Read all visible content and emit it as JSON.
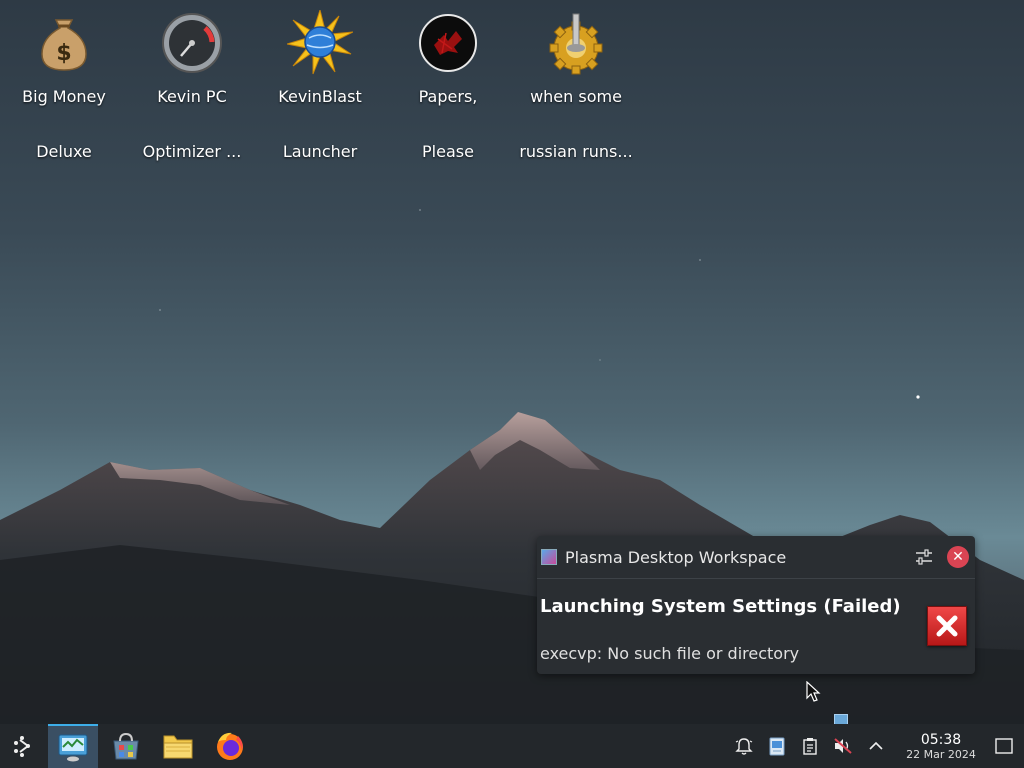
{
  "desktop": {
    "icons": [
      {
        "line1": "Big Money",
        "line2": "Deluxe",
        "icon": "money-bag-icon"
      },
      {
        "line1": "Kevin PC",
        "line2": "Optimizer ...",
        "icon": "speedometer-icon"
      },
      {
        "line1": "KevinBlast",
        "line2": "Launcher",
        "icon": "globe-starburst-icon"
      },
      {
        "line1": "Papers,",
        "line2": "Please",
        "icon": "papers-please-icon"
      },
      {
        "line1": "when some",
        "line2": "russian runs...",
        "icon": "gear-joystick-icon"
      }
    ]
  },
  "notification": {
    "app_name": "Plasma Desktop Workspace",
    "title": "Launching System Settings (Failed)",
    "body": "execvp: No such file or directory",
    "icon": "error-x-icon"
  },
  "taskbar": {
    "launcher_icon": "application-launcher-icon",
    "tasks": [
      {
        "icon": "system-monitor-icon",
        "active": true
      },
      {
        "icon": "software-store-icon",
        "active": false
      },
      {
        "icon": "file-manager-icon",
        "active": false
      },
      {
        "icon": "firefox-icon",
        "active": false
      }
    ],
    "tray": [
      "notifications-bell-icon",
      "clipboard-icon-blue",
      "clipboard-icon",
      "volume-muted-icon",
      "expand-tray-chevron-icon"
    ],
    "clock": {
      "time": "05:38",
      "date": "22 Mar 2024"
    }
  },
  "colors": {
    "accent": "#3daee9",
    "taskbar": "#23272b",
    "notification_bg": "#2a2e32",
    "error": "#da4453"
  }
}
